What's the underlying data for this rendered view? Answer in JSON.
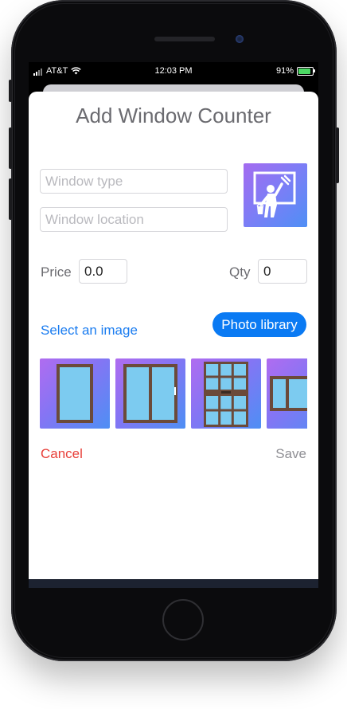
{
  "status_bar": {
    "carrier": "AT&T",
    "time": "12:03 PM",
    "battery": "91%"
  },
  "form": {
    "title": "Add Window Counter",
    "window_type": {
      "placeholder": "Window type",
      "value": ""
    },
    "window_location": {
      "placeholder": "Window location",
      "value": ""
    },
    "price": {
      "label": "Price",
      "value": "0.0"
    },
    "qty": {
      "label": "Qty",
      "value": "0"
    },
    "select_image_label": "Select an image",
    "photo_library_label": "Photo library",
    "gallery": [
      {
        "name": "single-window-thumb"
      },
      {
        "name": "double-window-thumb"
      },
      {
        "name": "grid-window-thumb"
      },
      {
        "name": "wide-window-thumb"
      }
    ],
    "cancel_label": "Cancel",
    "save_label": "Save"
  },
  "colors": {
    "accent": "#0a7af3",
    "cancel": "#e8403a",
    "save_disabled": "#8f8f94",
    "tile_gradient_start": "#a46bf0",
    "tile_gradient_end": "#4f8ff5",
    "glass": "#7ccbf0",
    "frame": "#6b4a3a"
  }
}
